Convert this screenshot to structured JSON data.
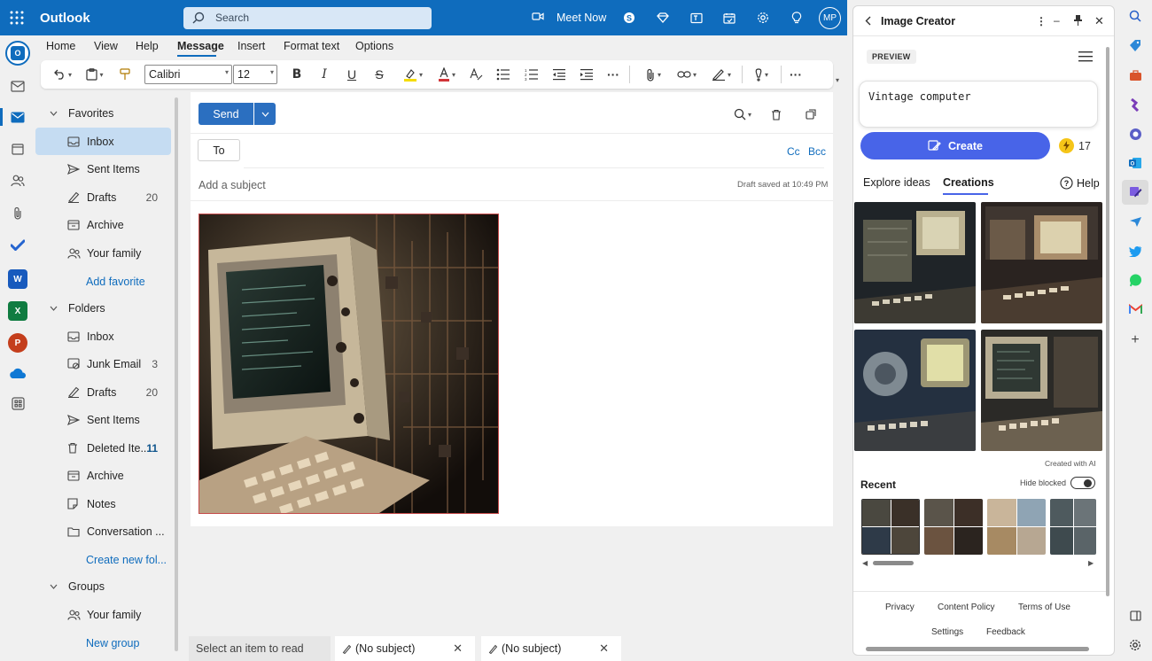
{
  "app": {
    "name": "Outlook"
  },
  "topbar": {
    "search_placeholder": "Search",
    "meet_now": "Meet Now",
    "avatar_initials": "MP"
  },
  "ribbon": {
    "tabs": [
      "Home",
      "View",
      "Help",
      "Message",
      "Insert",
      "Format text",
      "Options"
    ],
    "active_tab": "Message",
    "font_name": "Calibri",
    "font_size": "12"
  },
  "folders": {
    "favorites_header": "Favorites",
    "favorites": [
      {
        "label": "Inbox",
        "icon": "inbox-icon",
        "count": ""
      },
      {
        "label": "Sent Items",
        "icon": "send-icon",
        "count": ""
      },
      {
        "label": "Drafts",
        "icon": "pencil-icon",
        "count": "20"
      },
      {
        "label": "Archive",
        "icon": "archive-icon",
        "count": ""
      },
      {
        "label": "Your family",
        "icon": "people-icon",
        "count": ""
      }
    ],
    "add_favorite": "Add favorite",
    "folders_header": "Folders",
    "folders": [
      {
        "label": "Inbox",
        "icon": "inbox-icon",
        "count": ""
      },
      {
        "label": "Junk Email",
        "icon": "junk-icon",
        "count": "3"
      },
      {
        "label": "Drafts",
        "icon": "pencil-icon",
        "count": "20"
      },
      {
        "label": "Sent Items",
        "icon": "send-icon",
        "count": ""
      },
      {
        "label": "Deleted Ite...",
        "icon": "trash-icon",
        "count": "11"
      },
      {
        "label": "Archive",
        "icon": "archive-icon",
        "count": ""
      },
      {
        "label": "Notes",
        "icon": "note-icon",
        "count": ""
      },
      {
        "label": "Conversation ...",
        "icon": "folder-icon",
        "count": ""
      }
    ],
    "create_new_folder": "Create new fol...",
    "groups_header": "Groups",
    "groups": [
      {
        "label": "Your family",
        "icon": "people-icon"
      }
    ],
    "new_group": "New group"
  },
  "compose": {
    "send": "Send",
    "to": "To",
    "cc": "Cc",
    "bcc": "Bcc",
    "subject_placeholder": "Add a subject",
    "draft_status": "Draft saved at 10:49 PM"
  },
  "bottom_tabs": {
    "select_item": "Select an item to read",
    "draft_tab_1": "(No subject)",
    "draft_tab_2": "(No subject)"
  },
  "image_creator": {
    "title": "Image Creator",
    "badge": "PREVIEW",
    "prompt": "Vintage computer",
    "create": "Create",
    "boost_count": "17",
    "tab_explore": "Explore ideas",
    "tab_creations": "Creations",
    "help": "Help",
    "created_with_ai": "Created with AI",
    "recent": "Recent",
    "hide_blocked": "Hide blocked",
    "footer": {
      "privacy": "Privacy",
      "content_policy": "Content Policy",
      "terms": "Terms of Use",
      "settings": "Settings",
      "feedback": "Feedback"
    }
  },
  "colors": {
    "brand": "#0f6cbd",
    "create_button": "#4864e8",
    "selected_folder": "#c5dcf2"
  }
}
